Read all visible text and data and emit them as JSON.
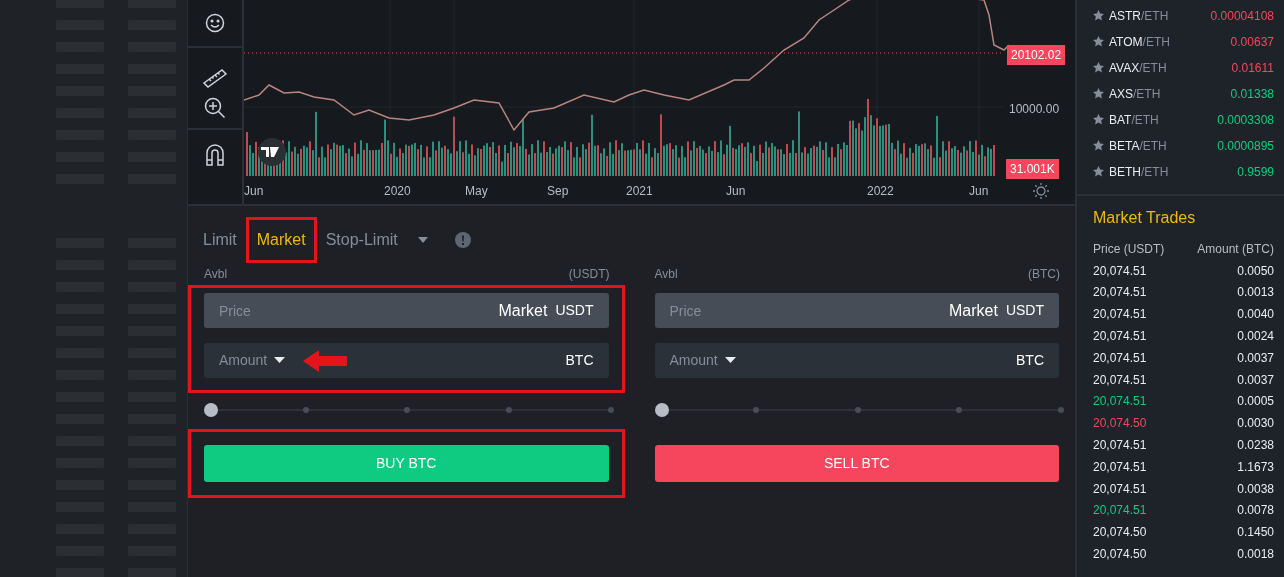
{
  "chart": {
    "price_labels": [
      "10000.00"
    ],
    "last_price": "20102.02",
    "volume_label": "31.001K",
    "x_labels": [
      "Jun",
      "2020",
      "May",
      "Sep",
      "2021",
      "Jun",
      "2022",
      "Jun"
    ]
  },
  "order_tabs": [
    {
      "label": "Limit",
      "selected": false,
      "highlighted": false
    },
    {
      "label": "Market",
      "selected": true,
      "highlighted": true
    },
    {
      "label": "Stop-Limit",
      "selected": false,
      "highlighted": false
    }
  ],
  "forms": [
    {
      "kind": "buy",
      "avbl_label": "Avbl",
      "avbl_unit": "(USDT)",
      "fields_highlighted": true,
      "price": {
        "placeholder": "Price",
        "value": "Market",
        "unit": "USDT"
      },
      "amount": {
        "label": "Amount",
        "unit": "BTC",
        "arrow": true
      },
      "slider": {
        "level": 0
      },
      "button": {
        "label": "BUY BTC",
        "highlighted": true
      }
    },
    {
      "kind": "sell",
      "avbl_label": "Avbl",
      "avbl_unit": "(BTC)",
      "fields_highlighted": false,
      "price": {
        "placeholder": "Price",
        "value": "Market",
        "unit": "USDT"
      },
      "amount": {
        "label": "Amount",
        "unit": "BTC",
        "arrow": false
      },
      "slider": {
        "level": 0
      },
      "button": {
        "label": "SELL BTC",
        "highlighted": false
      }
    }
  ],
  "pairs": [
    {
      "base": "ASTR",
      "quote": "/ETH",
      "price": "0.00004108",
      "color": "#f6465d"
    },
    {
      "base": "ATOM",
      "quote": "/ETH",
      "price": "0.00637",
      "color": "#f6465d"
    },
    {
      "base": "AVAX",
      "quote": "/ETH",
      "price": "0.01611",
      "color": "#f6465d"
    },
    {
      "base": "AXS",
      "quote": "/ETH",
      "price": "0.01338",
      "color": "#0ecb81"
    },
    {
      "base": "BAT",
      "quote": "/ETH",
      "price": "0.0003308",
      "color": "#0ecb81"
    },
    {
      "base": "BETA",
      "quote": "/ETH",
      "price": "0.0000895",
      "color": "#0ecb81"
    },
    {
      "base": "BETH",
      "quote": "/ETH",
      "price": "0.9599",
      "color": "#0ecb81"
    }
  ],
  "market_trades": {
    "title": "Market Trades",
    "columns": [
      "Price (USDT)",
      "Amount (BTC)"
    ],
    "rows": [
      {
        "price": "20,074.51",
        "amount": "0.0050",
        "color": "#eaecef"
      },
      {
        "price": "20,074.51",
        "amount": "0.0013",
        "color": "#eaecef"
      },
      {
        "price": "20,074.51",
        "amount": "0.0040",
        "color": "#eaecef"
      },
      {
        "price": "20,074.51",
        "amount": "0.0024",
        "color": "#eaecef"
      },
      {
        "price": "20,074.51",
        "amount": "0.0037",
        "color": "#eaecef"
      },
      {
        "price": "20,074.51",
        "amount": "0.0037",
        "color": "#eaecef"
      },
      {
        "price": "20,074.51",
        "amount": "0.0005",
        "color": "#0ecb81"
      },
      {
        "price": "20,074.50",
        "amount": "0.0030",
        "color": "#f6465d"
      },
      {
        "price": "20,074.51",
        "amount": "0.0238",
        "color": "#eaecef"
      },
      {
        "price": "20,074.51",
        "amount": "1.1673",
        "color": "#eaecef"
      },
      {
        "price": "20,074.51",
        "amount": "0.0038",
        "color": "#eaecef"
      },
      {
        "price": "20,074.51",
        "amount": "0.0078",
        "color": "#0ecb81"
      },
      {
        "price": "20,074.50",
        "amount": "0.1450",
        "color": "#eaecef"
      },
      {
        "price": "20,074.50",
        "amount": "0.0018",
        "color": "#eaecef"
      }
    ]
  }
}
